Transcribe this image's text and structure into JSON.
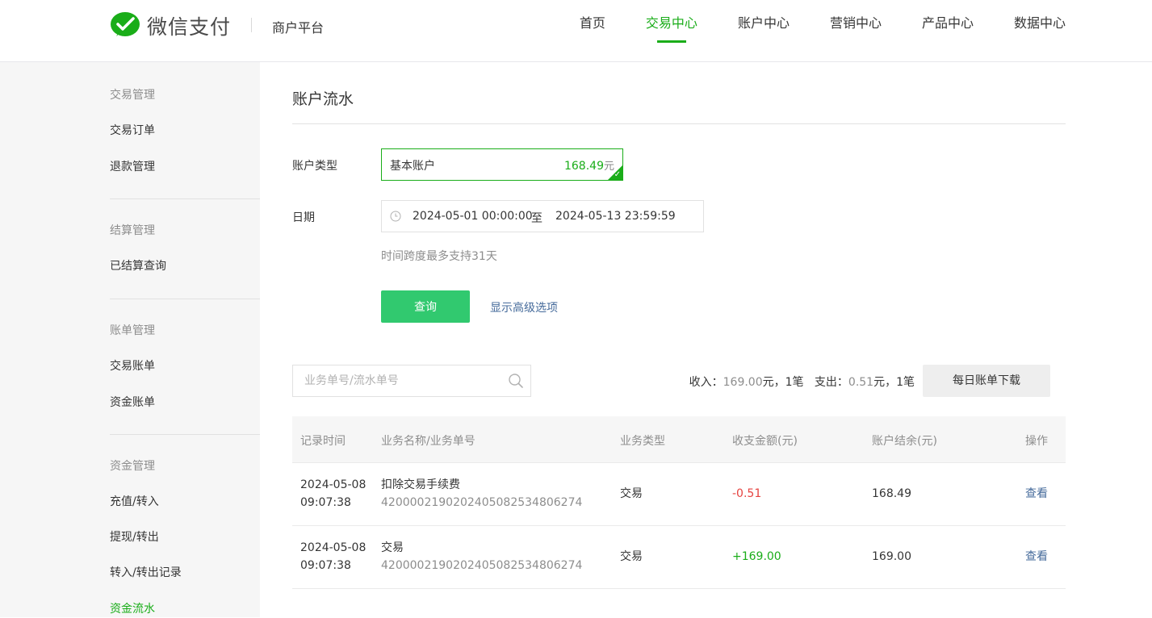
{
  "header": {
    "brand": "微信支付",
    "platform": "商户平台",
    "nav": [
      "首页",
      "交易中心",
      "账户中心",
      "营销中心",
      "产品中心",
      "数据中心"
    ],
    "active_nav": "交易中心"
  },
  "sidebar": {
    "groups": [
      {
        "title": "交易管理",
        "items": [
          "交易订单",
          "退款管理"
        ]
      },
      {
        "title": "结算管理",
        "items": [
          "已结算查询"
        ]
      },
      {
        "title": "账单管理",
        "items": [
          "交易账单",
          "资金账单"
        ]
      },
      {
        "title": "资金管理",
        "items": [
          "充值/转入",
          "提现/转出",
          "转入/转出记录",
          "资金流水"
        ]
      }
    ],
    "active_item": "资金流水"
  },
  "main": {
    "title": "账户流水",
    "account_type_label": "账户类型",
    "account_name": "基本账户",
    "account_amount": "168.49",
    "account_unit": "元",
    "date_label": "日期",
    "date_start": "2024-05-01 00:00:00",
    "date_to": "至",
    "date_end": "2024-05-13 23:59:59",
    "date_hint": "时间跨度最多支持31天",
    "query_button": "查询",
    "advanced_link": "显示高级选项",
    "search_placeholder": "业务单号/流水单号",
    "summary": {
      "income_label": "收入：",
      "income_amount": "169.00",
      "income_suffix": "元，1笔",
      "expense_label": "支出：",
      "expense_amount": "0.51",
      "expense_suffix": "元，1笔"
    },
    "download_button": "每日账单下载",
    "table": {
      "headers": [
        "记录时间",
        "业务名称/业务单号",
        "业务类型",
        "收支金额(元)",
        "账户结余(元)",
        "操作"
      ],
      "rows": [
        {
          "date": "2024-05-08",
          "time": "09:07:38",
          "name": "扣除交易手续费",
          "order_no": "4200002190202405082534806274",
          "type": "交易",
          "amount": "-0.51",
          "balance": "168.49",
          "action": "查看"
        },
        {
          "date": "2024-05-08",
          "time": "09:07:38",
          "name": "交易",
          "order_no": "4200002190202405082534806274",
          "type": "交易",
          "amount": "+169.00",
          "balance": "169.00",
          "action": "查看"
        }
      ]
    }
  },
  "colors": {
    "brand_green": "#1aad19",
    "button_green": "#31c96f",
    "link_blue": "#466b9b",
    "negative_red": "#e64340"
  },
  "icons": [
    "wechat-pay-logo-icon",
    "clock-icon",
    "search-icon",
    "check-icon"
  ]
}
